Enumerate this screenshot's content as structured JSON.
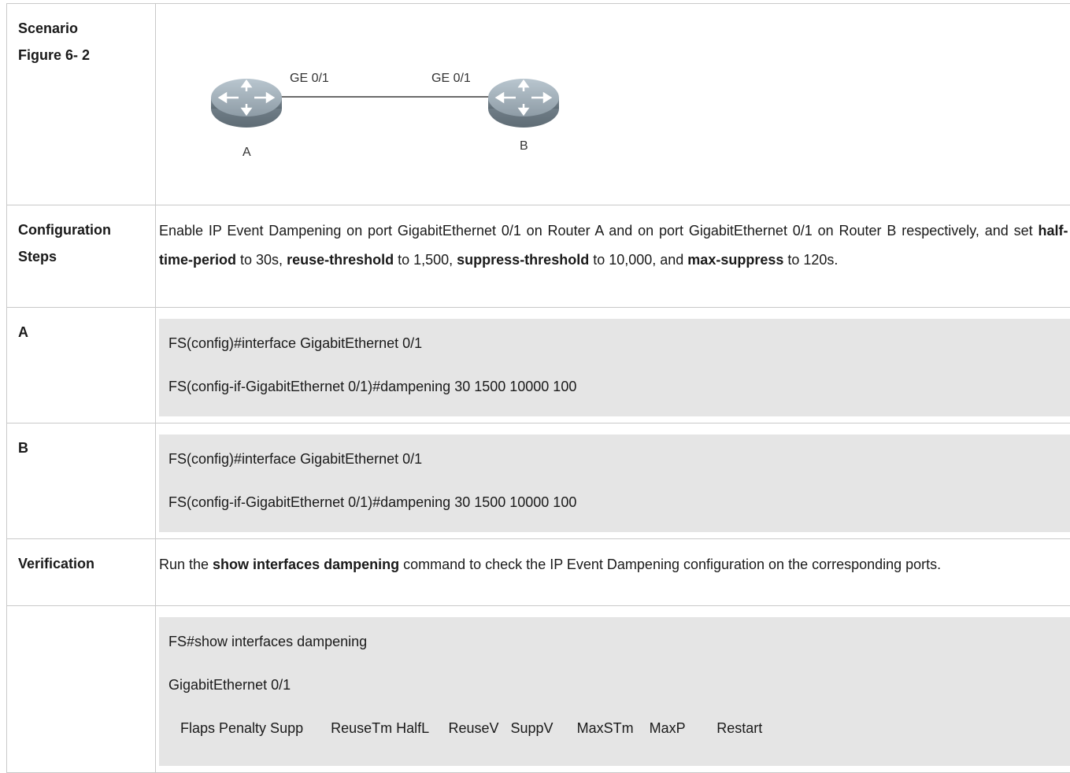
{
  "scenario": {
    "label_line1": "Scenario",
    "label_line2": "Figure 6- 2",
    "router_a_label": "A",
    "router_b_label": "B",
    "port_a_label": "GE 0/1",
    "port_b_label": "GE 0/1",
    "router_color": "#7c8b96"
  },
  "config_steps": {
    "label_line1": "Configuration",
    "label_line2": "Steps",
    "text_1": "Enable IP Event Dampening on port GigabitEthernet 0/1 on Router A and on port GigabitEthernet 0/1 on Router B respectively, and set ",
    "bold_1": "half-time-period",
    "text_2": " to 30s, ",
    "bold_2": "reuse-threshold",
    "text_3": " to 1,500, ",
    "bold_3": "suppress-threshold",
    "text_4": " to 10,000, and ",
    "bold_4": "max-suppress",
    "text_5": " to 120s."
  },
  "router_a": {
    "label": "A",
    "lines": [
      "FS(config)#interface GigabitEthernet 0/1",
      "FS(config-if-GigabitEthernet 0/1)#dampening 30 1500 10000 100"
    ]
  },
  "router_b": {
    "label": "B",
    "lines": [
      "FS(config)#interface GigabitEthernet 0/1",
      "FS(config-if-GigabitEthernet 0/1)#dampening 30 1500 10000 100"
    ]
  },
  "verification": {
    "label": "Verification",
    "text_1": "Run the ",
    "bold_1": "show interfaces dampening",
    "text_2": " command to check the IP Event Dampening configuration on the corresponding ports."
  },
  "output": {
    "lines": [
      "FS#show interfaces dampening",
      "GigabitEthernet 0/1",
      "   Flaps Penalty Supp       ReuseTm HalfL     ReuseV   SuppV      MaxSTm    MaxP        Restart"
    ]
  }
}
